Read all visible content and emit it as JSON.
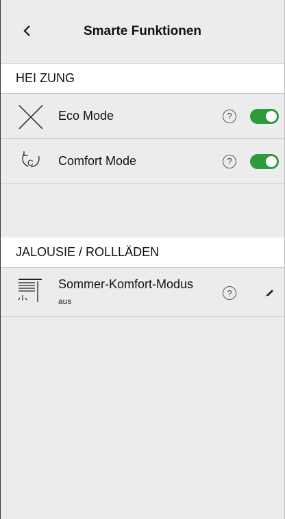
{
  "header": {
    "title": "Smarte Funktionen"
  },
  "sections": {
    "heating": {
      "label": "HEI ZUNG"
    },
    "blinds": {
      "label": "JALOUSIE / ROLLLÄDEN"
    }
  },
  "rows": {
    "eco": {
      "label": "Eco Mode",
      "enabled": true
    },
    "comfort": {
      "label": "Comfort Mode",
      "enabled": true
    },
    "sommer": {
      "label": "Sommer-Komfort-Modus",
      "status": "aus"
    }
  },
  "icons": {
    "help": "?",
    "back": "chevron-left-icon",
    "edit": "pencil-icon"
  },
  "colors": {
    "toggle_on": "#2d9a3b"
  }
}
